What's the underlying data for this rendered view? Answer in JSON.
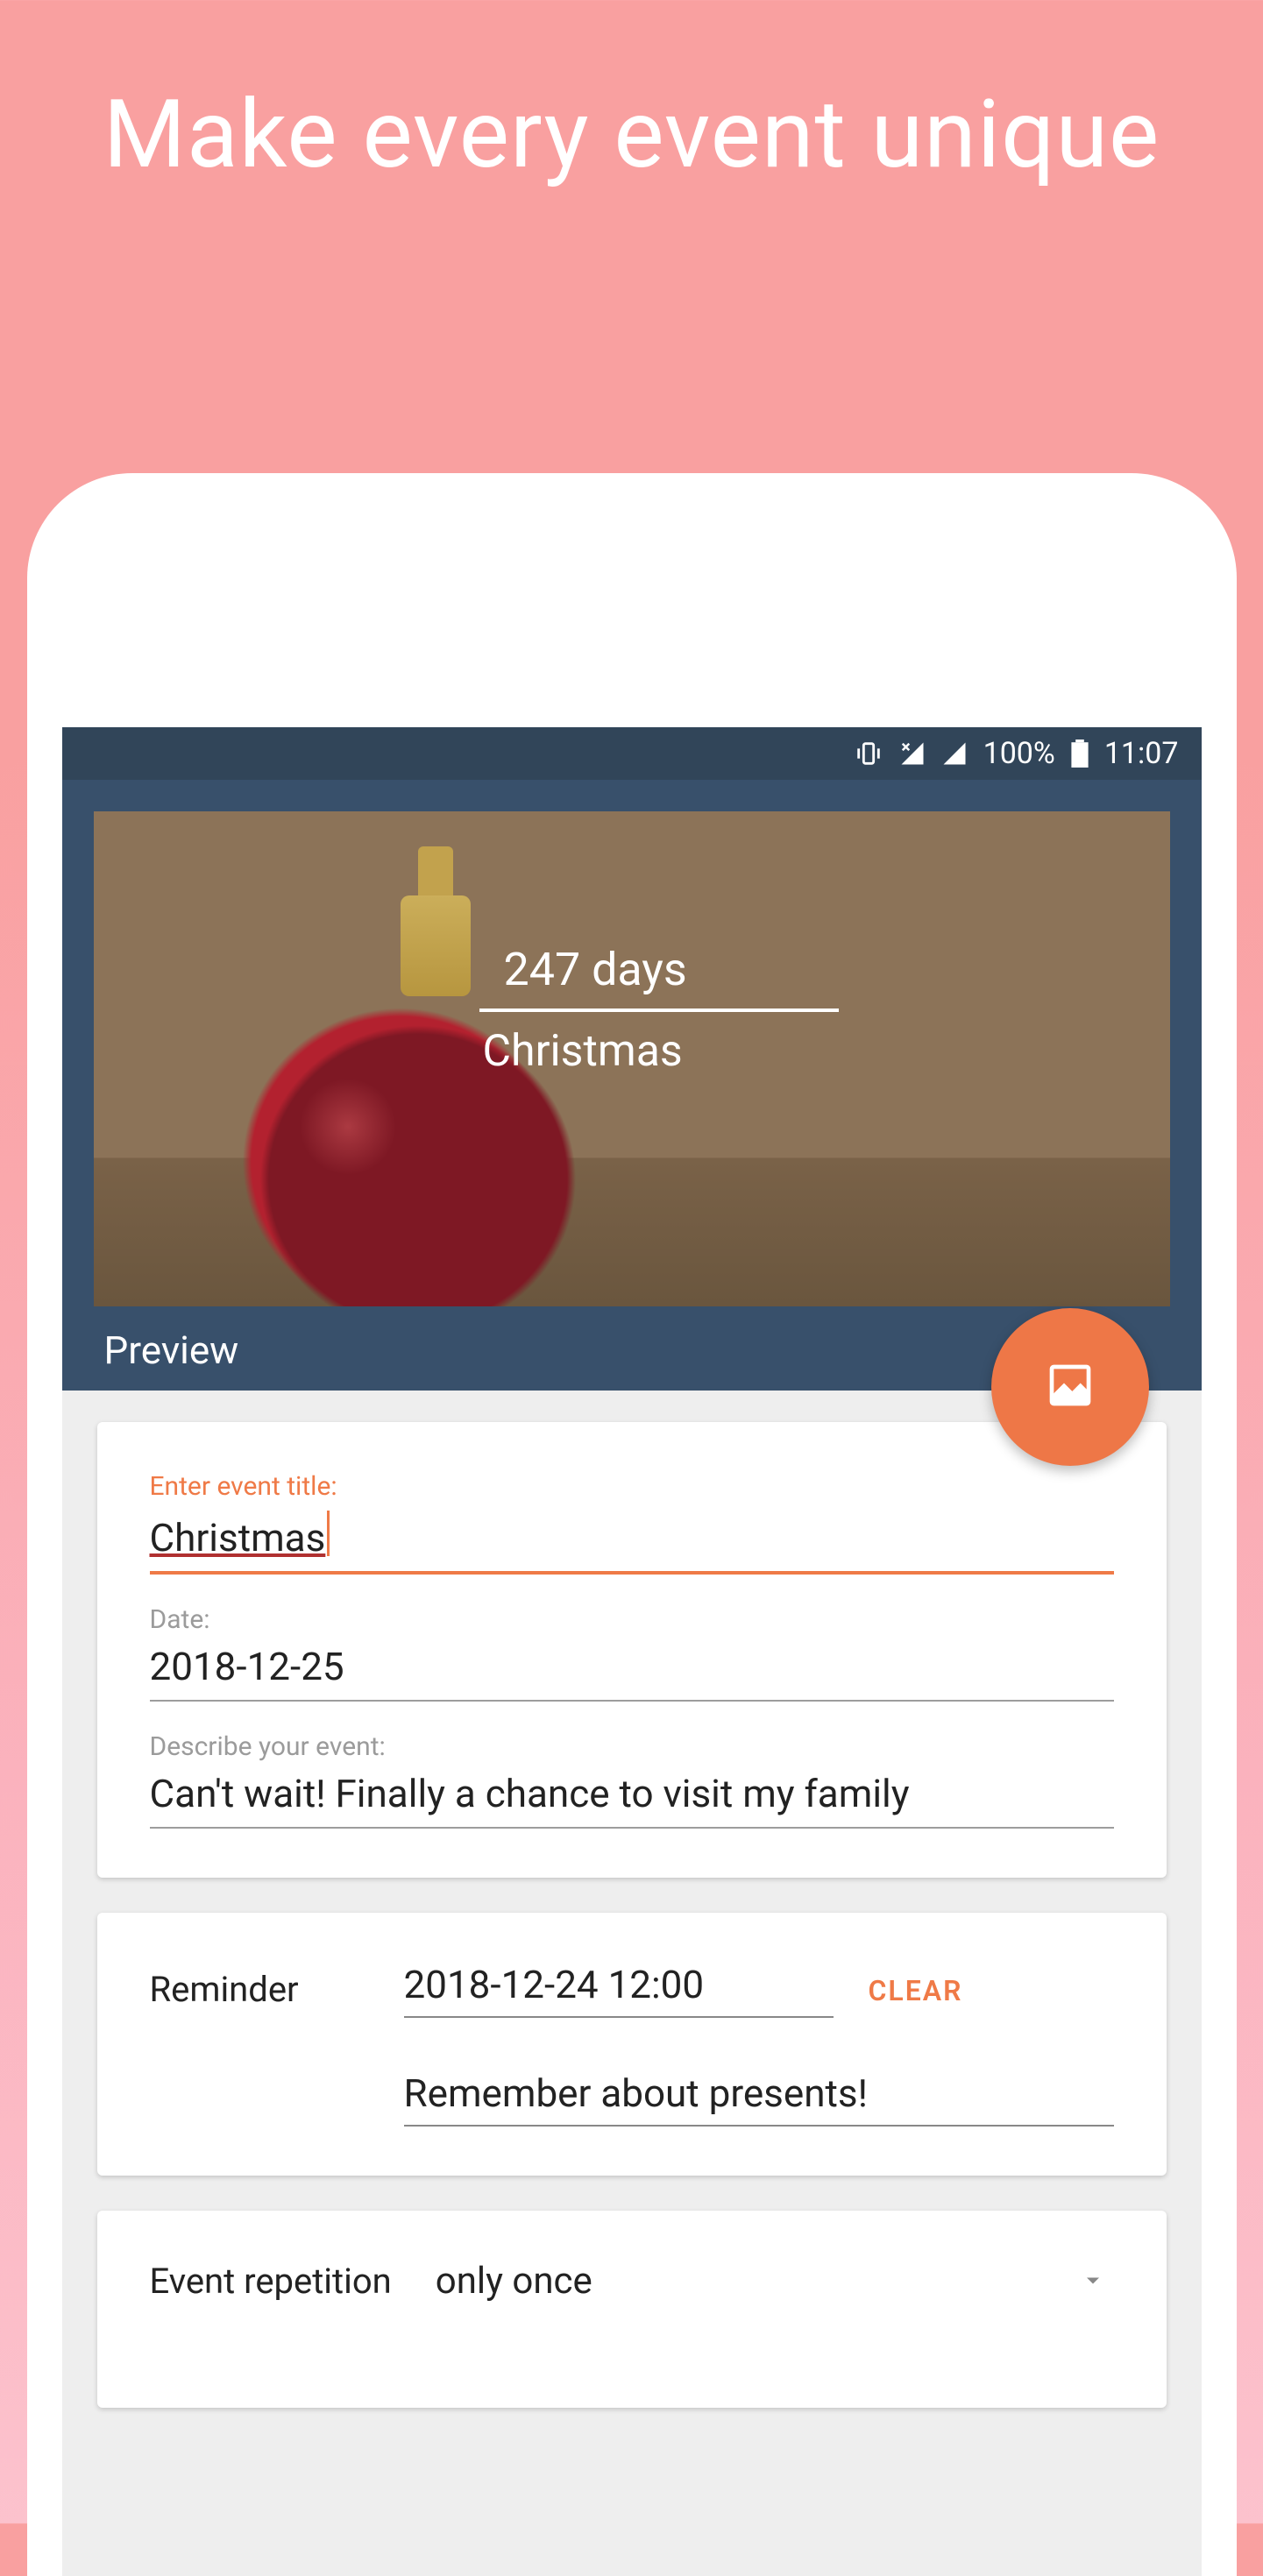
{
  "promo": {
    "title": "Make every event unique"
  },
  "status": {
    "battery": "100%",
    "time": "11:07"
  },
  "preview": {
    "days": "247 days",
    "event_name": "Christmas",
    "label": "Preview"
  },
  "form": {
    "title_label": "Enter event title:",
    "title_value": "Christmas",
    "date_label": "Date:",
    "date_value": "2018-12-25",
    "desc_label": "Describe your event:",
    "desc_value": "Can't wait! Finally a chance to visit my family"
  },
  "reminder": {
    "label": "Reminder",
    "datetime": "2018-12-24 12:00",
    "clear": "CLEAR",
    "note": "Remember about presents!"
  },
  "repetition": {
    "label": "Event repetition",
    "value": "only once"
  }
}
